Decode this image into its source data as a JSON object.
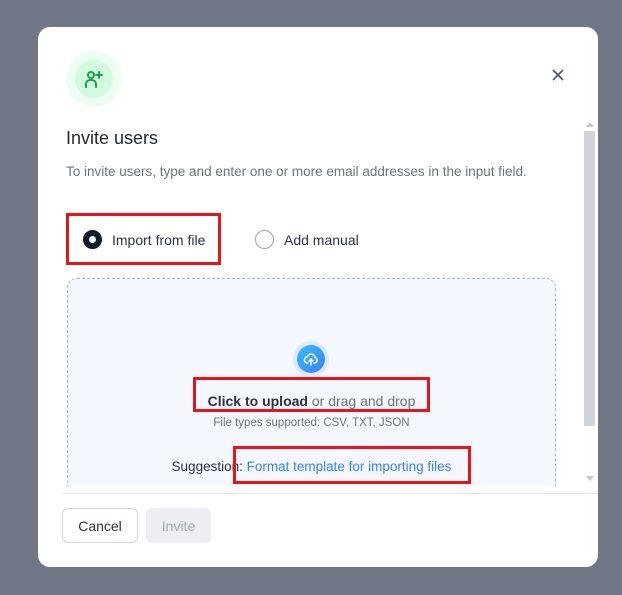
{
  "dialog": {
    "title": "Invite users",
    "description": "To invite users, type and enter one or more email addresses in the input field.",
    "icon": "user-plus-icon",
    "accent_color": "#3b82f6",
    "options": [
      {
        "label": "Import from file",
        "selected": true
      },
      {
        "label": "Add manual",
        "selected": false
      }
    ],
    "upload": {
      "click_label": "Click to upload",
      "drag_label": " or drag and drop",
      "file_types": "File types supported: CSV, TXT, JSON",
      "suggestion_label": "Suggestion: ",
      "suggestion_link": "Format template for importing files"
    },
    "footer": {
      "cancel": "Cancel",
      "invite": "Invite"
    }
  }
}
